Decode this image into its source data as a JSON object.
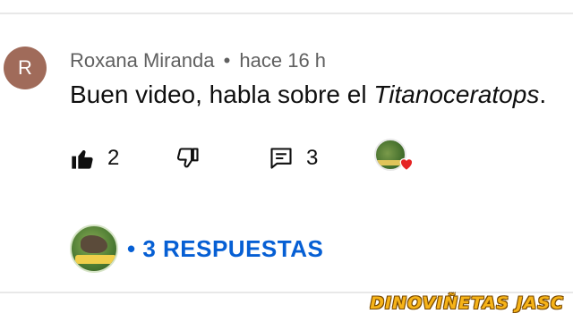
{
  "comment": {
    "author_initial": "R",
    "author": "Roxana Miranda",
    "separator": "•",
    "time": "hace 16 h",
    "text_prefix": "Buen video, habla sobre el ",
    "text_italic": "Titanoceratops",
    "text_suffix": "."
  },
  "actions": {
    "like_icon": "thumbs-up-filled",
    "like_count": "2",
    "dislike_icon": "thumbs-down-outline",
    "reply_icon": "comment-icon",
    "reply_count": "3",
    "creator_heart": true
  },
  "replies": {
    "label": "• 3 RESPUESTAS",
    "color": "#065fd4"
  },
  "watermark": {
    "text": "DINOVIÑETAS JASC",
    "color": "#f6b318"
  },
  "colors": {
    "avatar_bg": "#a06b5a",
    "meta_text": "#606060",
    "body_text": "#0f0f0f",
    "heart": "#e52424"
  }
}
